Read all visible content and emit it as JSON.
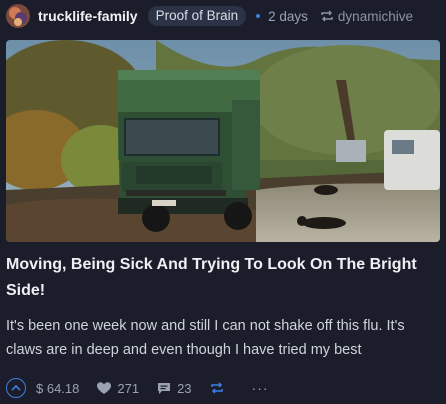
{
  "post": {
    "author": "trucklife-family",
    "community": "Proof of Brain",
    "age": "2 days",
    "reblogged_by": "dynamichive",
    "title": "Moving, Being Sick And Trying To Look On The Bright Side!",
    "excerpt": "It's been one week now and still I can not shake off this flu. It's claws are in deep and even though I have tried my best"
  },
  "stats": {
    "payout": "$ 64.18",
    "votes": "271",
    "comments": "23",
    "more": "···"
  },
  "icons": {
    "reblog": "reblog-icon",
    "upvote": "upvote-icon",
    "heart": "heart-icon",
    "comment": "comment-icon",
    "more": "more-icon"
  },
  "colors": {
    "background": "#1b1e2a",
    "accent": "#3f7ee6",
    "badge": "#2c3346"
  }
}
